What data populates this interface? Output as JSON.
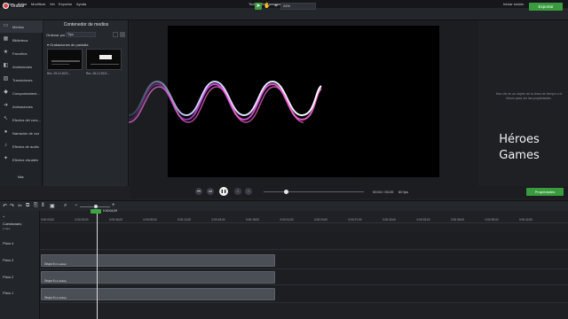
{
  "menu": [
    "Archivo",
    "Editar",
    "Modificar",
    "Ver",
    "Exportar",
    "Ayuda"
  ],
  "app_title": "TechSmith Camtasia - Proyecto sin título*",
  "signin": "Iniciar sesión",
  "toolbar": {
    "record_label": "Grabar",
    "zoom_value": "24%",
    "export_label": "Exportar"
  },
  "sidebar": {
    "items": [
      {
        "label": "Medios",
        "icon": "film-icon"
      },
      {
        "label": "Biblioteca",
        "icon": "library-icon"
      },
      {
        "label": "Favoritos",
        "icon": "star-icon"
      },
      {
        "label": "Anotaciones",
        "icon": "annotation-icon"
      },
      {
        "label": "Transiciones",
        "icon": "transition-icon"
      },
      {
        "label": "Comportamient...",
        "icon": "behavior-icon"
      },
      {
        "label": "Animaciones",
        "icon": "animation-icon"
      },
      {
        "label": "Efectos del curs...",
        "icon": "cursor-icon"
      },
      {
        "label": "Narración de voz",
        "icon": "mic-icon"
      },
      {
        "label": "Efectos de audio",
        "icon": "audio-icon"
      },
      {
        "label": "Efectos visuales",
        "icon": "visual-effects-icon"
      }
    ],
    "more_label": "Más"
  },
  "bin": {
    "title": "Contenedor de medios",
    "sort_label": "Ordenar por",
    "sort_value": "Tipo",
    "group_label": "Grabaciones de pantalla",
    "thumbs": [
      {
        "caption": "Rec. 29-12-2021..."
      },
      {
        "caption": "Rec. 28-12-2021..."
      }
    ]
  },
  "properties": {
    "hint": "Haz clic en un objeto de la línea de tiempo o el lienzo para ver las propiedades.",
    "brand_line1": "Héroes",
    "brand_line2": "Games",
    "button_label": "Propiedades"
  },
  "transport": {
    "timecode": "00:04 / 00:20",
    "fps": "60 fps"
  },
  "timeline": {
    "playhead_time": "0:00:04;09",
    "ticks": [
      "0:00:00;00",
      "0:00:03;00",
      "0:00:06;00",
      "0:00:09;00",
      "0:00:12;00",
      "0:00:15;00",
      "0:00:18;00",
      "0:00:21;00",
      "0:00:24;00",
      "0:00:27;00",
      "0:00:30;00",
      "0:00:33;00",
      "0:00:36;00",
      "0:00:39;00",
      "0:00:42;00"
    ],
    "head_title": "Cuestionario",
    "head_sub": "2 clips",
    "tracks": [
      {
        "name": "Pista 4"
      },
      {
        "name": "Pista 3",
        "clip": "Grupo 6",
        "clip_meta": "(4 medios)"
      },
      {
        "name": "Pista 2",
        "clip": "Grupo 6",
        "clip_meta": "(4 medios)"
      },
      {
        "name": "Pista 1",
        "clip": "Grupo 6",
        "clip_meta": "(4 medios)"
      }
    ]
  },
  "colors": {
    "accent_green": "#3a9b3e",
    "record_red": "#e04343"
  }
}
